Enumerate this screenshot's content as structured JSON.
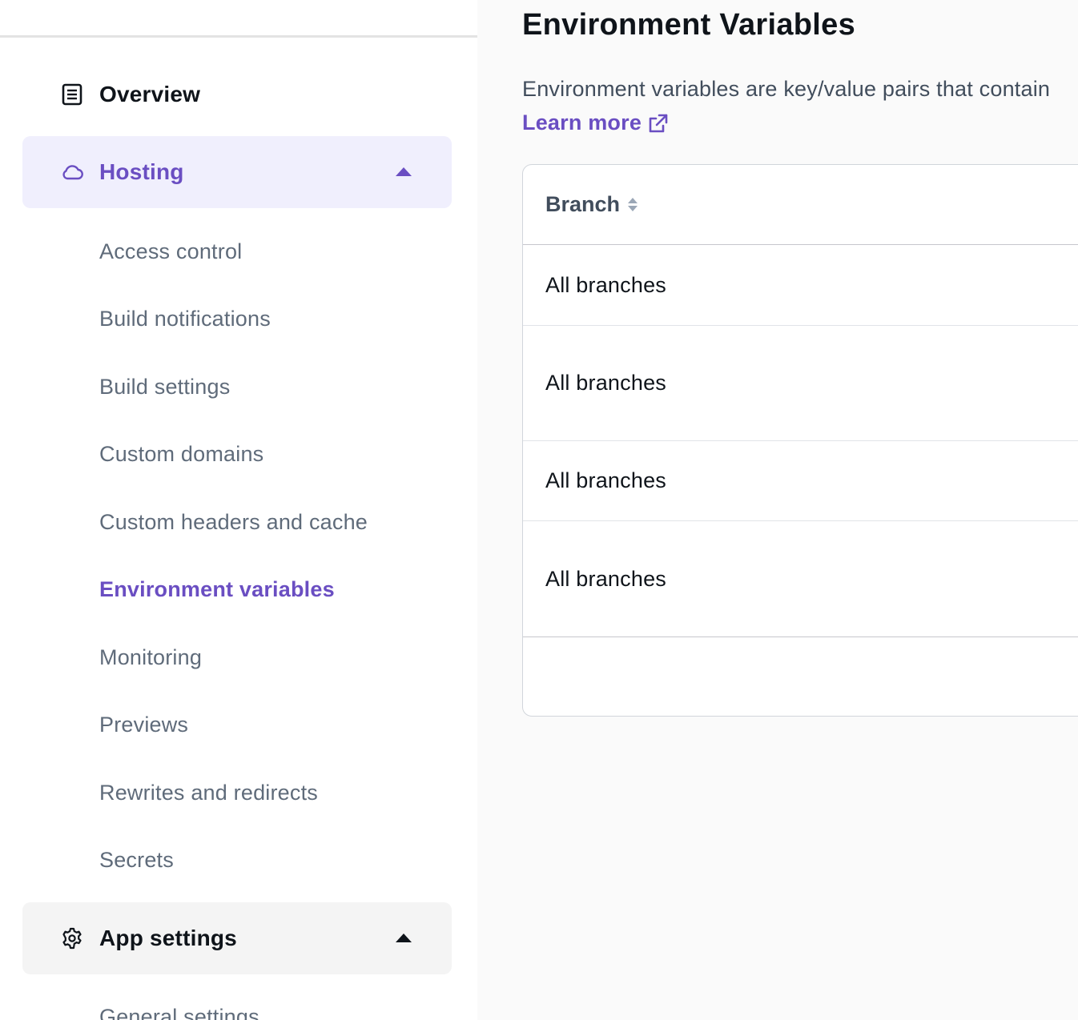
{
  "colors": {
    "accent": "#6a4ec2",
    "active_group_bg": "#f0effd",
    "group_bg": "#f4f4f4",
    "text_primary": "#0f141a",
    "text_secondary": "#5f6b7a"
  },
  "sidebar": {
    "overview": {
      "label": "Overview",
      "icon": "document-icon"
    },
    "hosting": {
      "label": "Hosting",
      "icon": "cloud-icon",
      "expanded": true,
      "items": [
        {
          "label": "Access control"
        },
        {
          "label": "Build notifications"
        },
        {
          "label": "Build settings"
        },
        {
          "label": "Custom domains"
        },
        {
          "label": "Custom headers and cache"
        },
        {
          "label": "Environment variables",
          "active": true
        },
        {
          "label": "Monitoring"
        },
        {
          "label": "Previews"
        },
        {
          "label": "Rewrites and redirects"
        },
        {
          "label": "Secrets"
        }
      ]
    },
    "app_settings": {
      "label": "App settings",
      "icon": "gear-icon",
      "expanded": true,
      "items": [
        {
          "label": "General settings"
        }
      ]
    }
  },
  "main": {
    "title": "Environment Variables",
    "description": "Environment variables are key/value pairs that contain",
    "learn_more": "Learn more",
    "table": {
      "columns": [
        {
          "label": "Branch",
          "sortable": true
        }
      ],
      "rows": [
        {
          "branch": "All branches"
        },
        {
          "branch": "All branches"
        },
        {
          "branch": "All branches"
        },
        {
          "branch": "All branches"
        }
      ]
    }
  }
}
